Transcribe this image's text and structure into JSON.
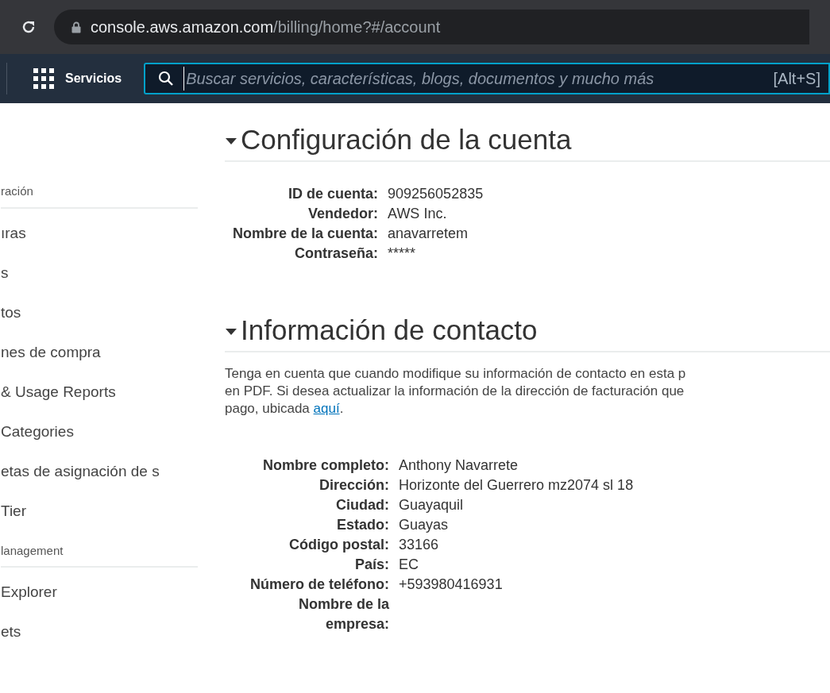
{
  "browser": {
    "url_host": "console.aws.amazon.com",
    "url_path": "/billing/home?#/account"
  },
  "nav": {
    "services": "Servicios",
    "search_placeholder": "Buscar servicios, características, blogs, documentos y mucho más",
    "shortcut": "[Alt+S]"
  },
  "sidebar": {
    "sections": [
      {
        "heading": "ración",
        "items": [
          "ıras",
          "s",
          "tos",
          "nes de compra",
          "& Usage Reports",
          "Categories",
          "etas de asignación de s",
          "Tier"
        ]
      },
      {
        "heading": "lanagement",
        "items": [
          "Explorer",
          "ets"
        ]
      }
    ]
  },
  "account": {
    "title": "Configuración de la cuenta",
    "expanded": true,
    "fields": [
      {
        "label": "ID de cuenta:",
        "value": "909256052835"
      },
      {
        "label": "Vendedor:",
        "value": "AWS Inc."
      },
      {
        "label": "Nombre de la cuenta:",
        "value": "anavarretem"
      },
      {
        "label": "Contraseña:",
        "value": "*****"
      }
    ]
  },
  "contact": {
    "title": "Información de contacto",
    "expanded": true,
    "note": {
      "lines": [
        "Tenga en cuenta que cuando modifique su información de contacto en esta p",
        "en PDF. Si desea actualizar la información de la dirección de facturación que",
        "pago, ubicada"
      ],
      "link": "aquí",
      "end": "."
    },
    "fields": [
      {
        "label": "Nombre completo:",
        "value": "Anthony Navarrete"
      },
      {
        "label": "Dirección:",
        "value": "Horizonte del Guerrero mz2074 sl 18"
      },
      {
        "label": "Ciudad:",
        "value": "Guayaquil"
      },
      {
        "label": "Estado:",
        "value": "Guayas"
      },
      {
        "label": "Código postal:",
        "value": "33166"
      },
      {
        "label": "País:",
        "value": "EC"
      },
      {
        "label": "Número de teléfono:",
        "value": "+593980416931"
      },
      {
        "label": "Nombre de la empresa:"
      }
    ]
  }
}
